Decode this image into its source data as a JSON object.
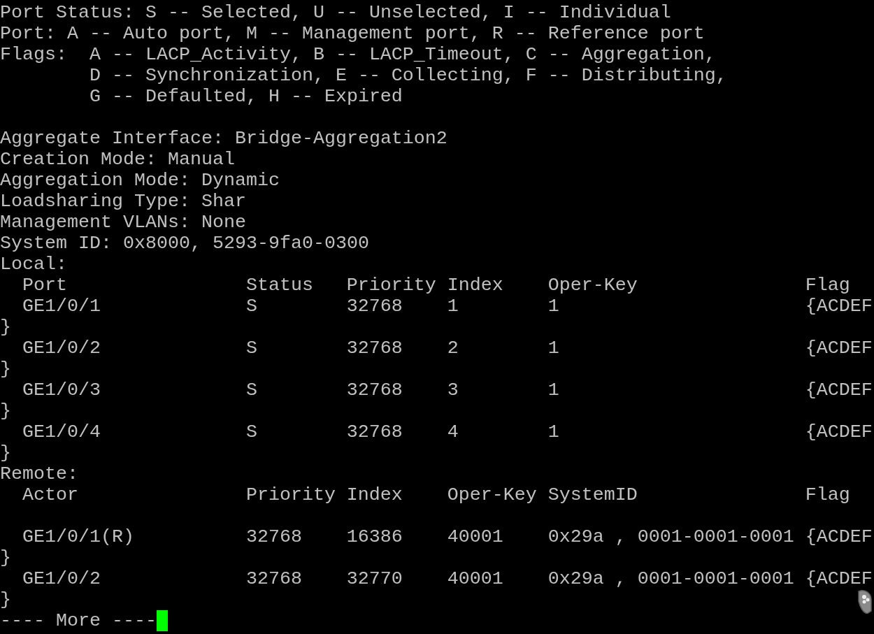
{
  "legend": [
    {
      "label": "Port Status:",
      "lines": [
        "S -- Selected, U -- Unselected, I -- Individual"
      ]
    },
    {
      "label": "Port:",
      "lines": [
        "A -- Auto port, M -- Management port, R -- Reference port"
      ]
    },
    {
      "label": "Flags:",
      "lines": [
        "A -- LACP_Activity, B -- LACP_Timeout, C -- Aggregation,",
        "D -- Synchronization, E -- Collecting, F -- Distributing,",
        "G -- Defaulted, H -- Expired"
      ]
    }
  ],
  "info": [
    "Aggregate Interface: Bridge-Aggregation2",
    "Creation Mode: Manual",
    "Aggregation Mode: Dynamic",
    "Loadsharing Type: Shar",
    "Management VLANs: None",
    "System ID: 0x8000, 5293-9fa0-0300"
  ],
  "tables": [
    {
      "kind": "local",
      "title": "Local:",
      "columns": [
        "Port",
        "Status",
        "Priority",
        "Index",
        "Oper-Key",
        "Flag"
      ],
      "rows": [
        {
          "cells": [
            "GE1/0/1",
            "S",
            "32768",
            "1",
            "1",
            "{ACDEF"
          ],
          "continuation": "}"
        },
        {
          "cells": [
            "GE1/0/2",
            "S",
            "32768",
            "2",
            "1",
            "{ACDEF"
          ],
          "continuation": "}"
        },
        {
          "cells": [
            "GE1/0/3",
            "S",
            "32768",
            "3",
            "1",
            "{ACDEF"
          ],
          "continuation": "}"
        },
        {
          "cells": [
            "GE1/0/4",
            "S",
            "32768",
            "4",
            "1",
            "{ACDEF"
          ],
          "continuation": "}"
        }
      ]
    },
    {
      "kind": "remote",
      "title": "Remote:",
      "columns": [
        "Actor",
        "Priority",
        "Index",
        "Oper-Key",
        "SystemID",
        "Flag"
      ],
      "rows": [
        {
          "cells": [
            "GE1/0/1(R)",
            "32768",
            "16386",
            "40001",
            "0x29a , 0001-0001-0001",
            "{ACDEF"
          ],
          "continuation": "}"
        },
        {
          "cells": [
            "GE1/0/2",
            "32768",
            "32770",
            "40001",
            "0x29a , 0001-0001-0001",
            "{ACDEF"
          ],
          "continuation": "}"
        }
      ]
    }
  ],
  "prompt": {
    "text": "---- More ----",
    "cursor": true
  }
}
